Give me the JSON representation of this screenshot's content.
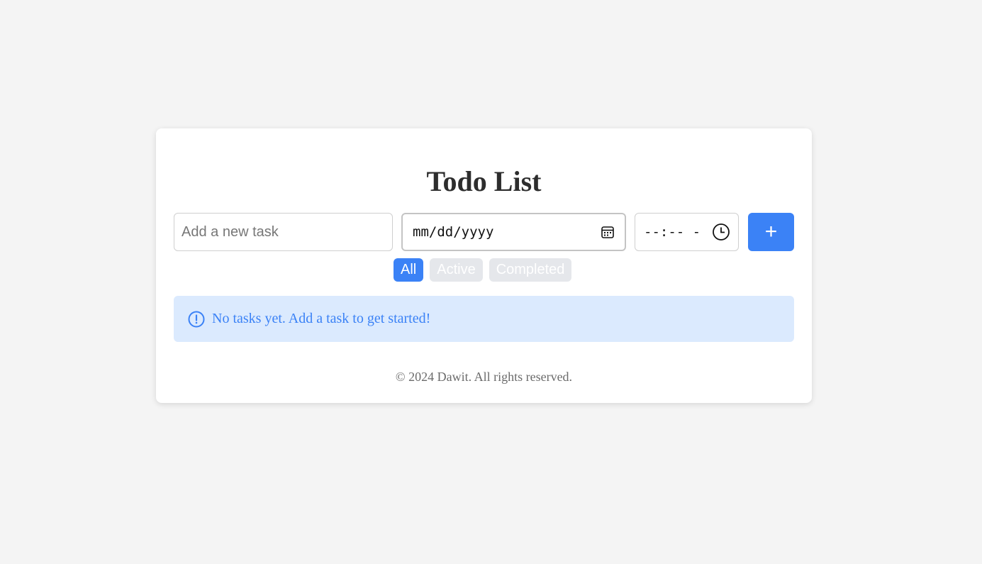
{
  "app": {
    "title": "Todo List"
  },
  "form": {
    "task_placeholder": "Add a new task",
    "task_value": "",
    "date_placeholder": "mm/dd/yyyy",
    "time_placeholder": "--:-- -",
    "add_label": "+"
  },
  "filters": {
    "items": [
      {
        "label": "All",
        "active": true
      },
      {
        "label": "Active",
        "active": false
      },
      {
        "label": "Completed",
        "active": false
      }
    ]
  },
  "empty_state": {
    "message": "No tasks yet. Add a task to get started!",
    "icon": "alert-circle-icon"
  },
  "footer": {
    "text": "© 2024 Dawit. All rights reserved."
  },
  "colors": {
    "accent": "#3b82f6",
    "alert_bg": "#dbeafe",
    "inactive_filter_bg": "#e5e7eb",
    "page_bg": "#f4f4f4"
  }
}
